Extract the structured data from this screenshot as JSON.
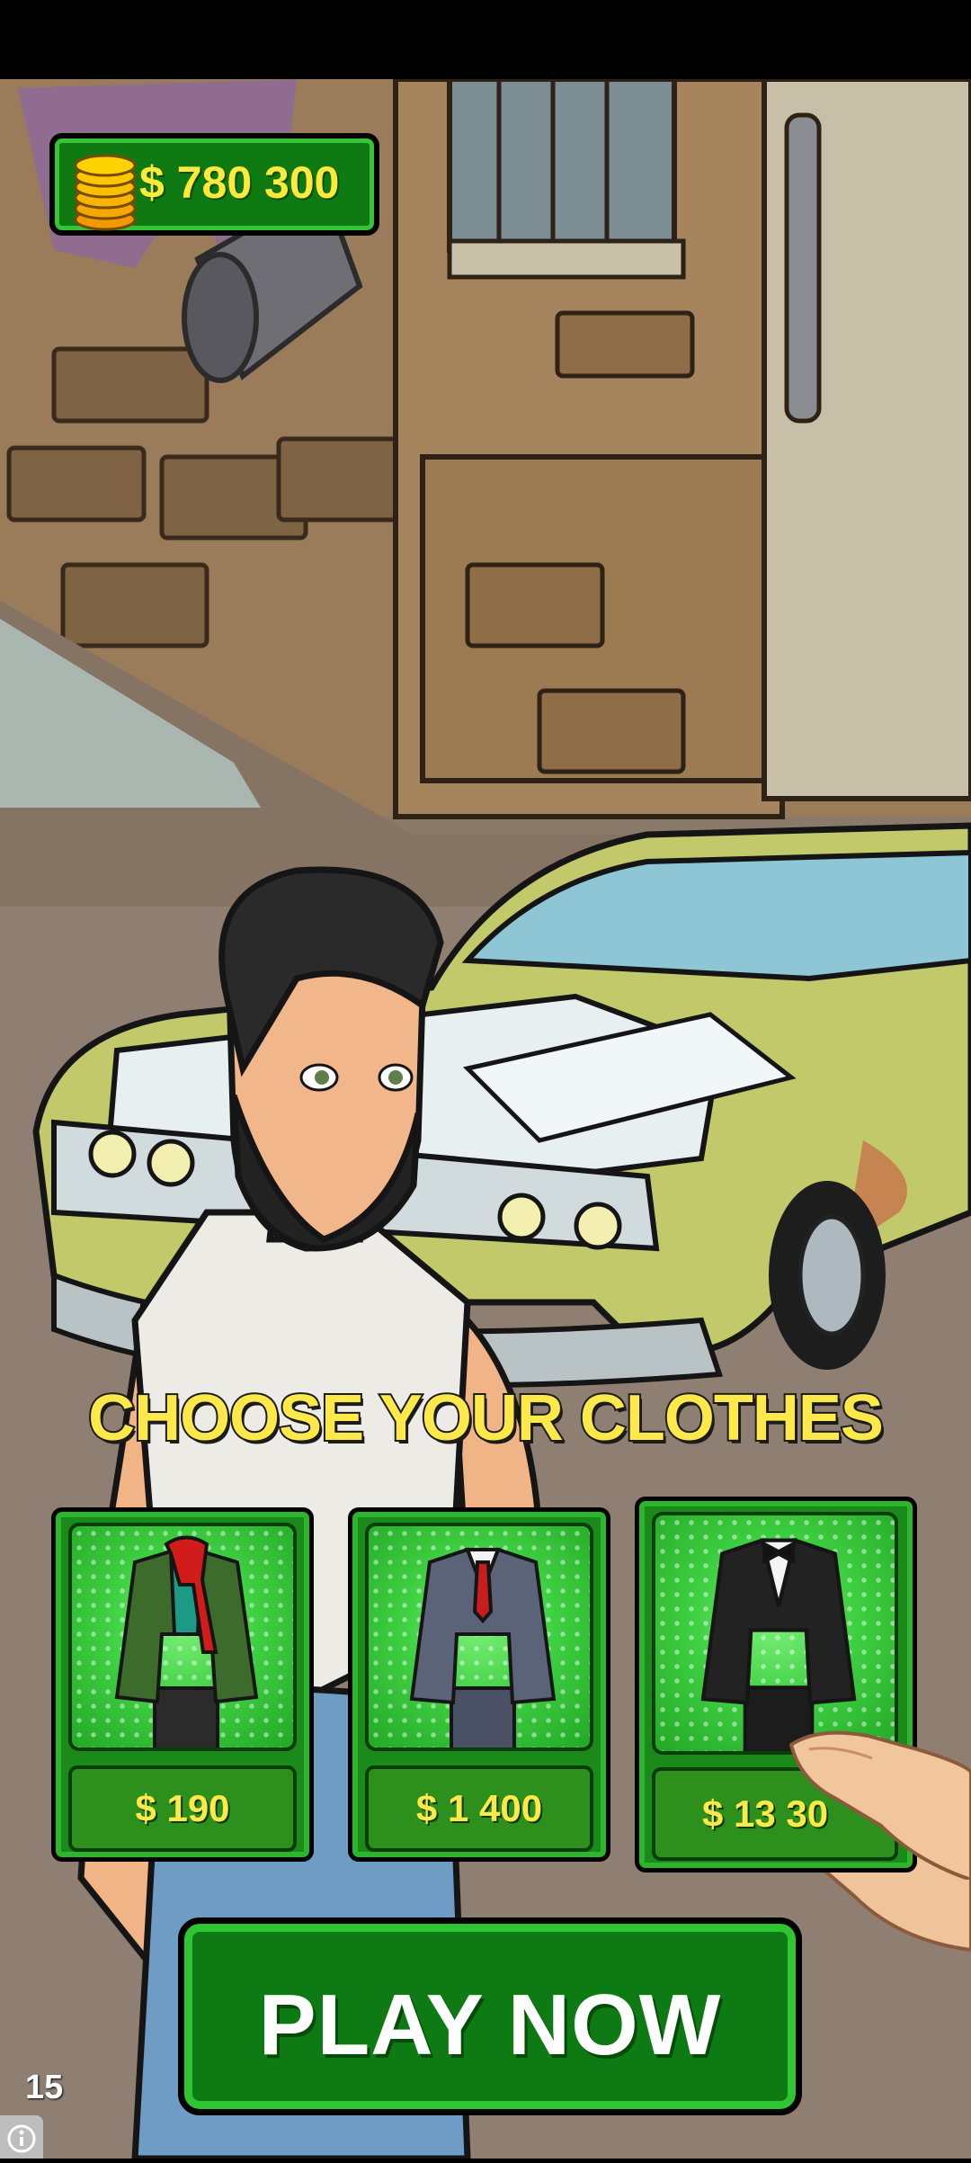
{
  "status_bar": {},
  "balance": {
    "amount": "$ 780 300",
    "icon": "coin-stack-icon"
  },
  "headline": "CHOOSE YOUR CLOTHES",
  "outfits": [
    {
      "name": "green jacket with red scarf",
      "price": "$ 190"
    },
    {
      "name": "grey business suit",
      "price": "$ 1 400"
    },
    {
      "name": "black tuxedo",
      "price": "$ 13 30"
    }
  ],
  "play_button": {
    "label": "PLAY NOW"
  },
  "ad_counter": "15",
  "colors": {
    "accent_green": "#0d7a14",
    "bright_green": "#2fc432",
    "price_yellow": "#ffe84a"
  }
}
